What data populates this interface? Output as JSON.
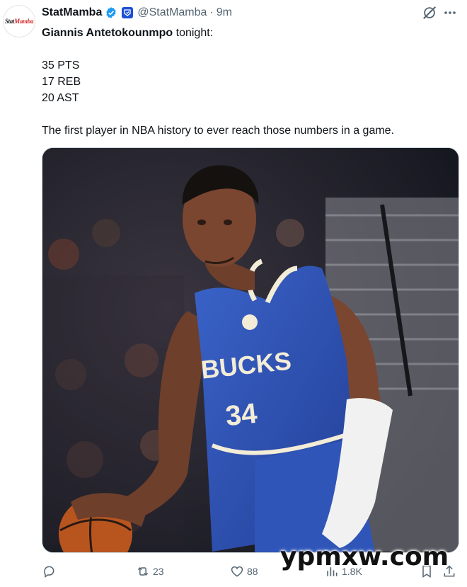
{
  "post": {
    "display_name": "StatMamba",
    "handle": "@StatMamba",
    "separator": "·",
    "time": "9m",
    "avatar": {
      "line1": "Stat",
      "line2": "Mamba"
    },
    "text": {
      "mention": "Giannis Antetokounmpo",
      "mention_suffix": " tonight:",
      "stat1": "35 PTS",
      "stat2": "17 REB",
      "stat3": "20 AST",
      "closing": "The first player in NBA history to ever reach those numbers in a game."
    },
    "media": {
      "jersey_wordmark": "BUCKS",
      "jersey_number": "34",
      "colors": {
        "jersey": "#2f55b8",
        "trim": "#f3ecd7",
        "skin": "#7a4630",
        "court_bg": "#1a1e2a"
      }
    }
  },
  "actions": {
    "reply": {
      "icon": "reply-icon",
      "count": ""
    },
    "retweet": {
      "icon": "retweet-icon",
      "count": "23"
    },
    "like": {
      "icon": "heart-icon",
      "count": "88"
    },
    "views": {
      "icon": "views-icon",
      "count": "1.8K"
    },
    "bookmark": {
      "icon": "bookmark-icon"
    },
    "share": {
      "icon": "share-icon"
    }
  },
  "watermark": "ypmxw.com",
  "colors": {
    "accent": "#1d9bf0",
    "muted": "#536471",
    "text": "#0f1419"
  }
}
